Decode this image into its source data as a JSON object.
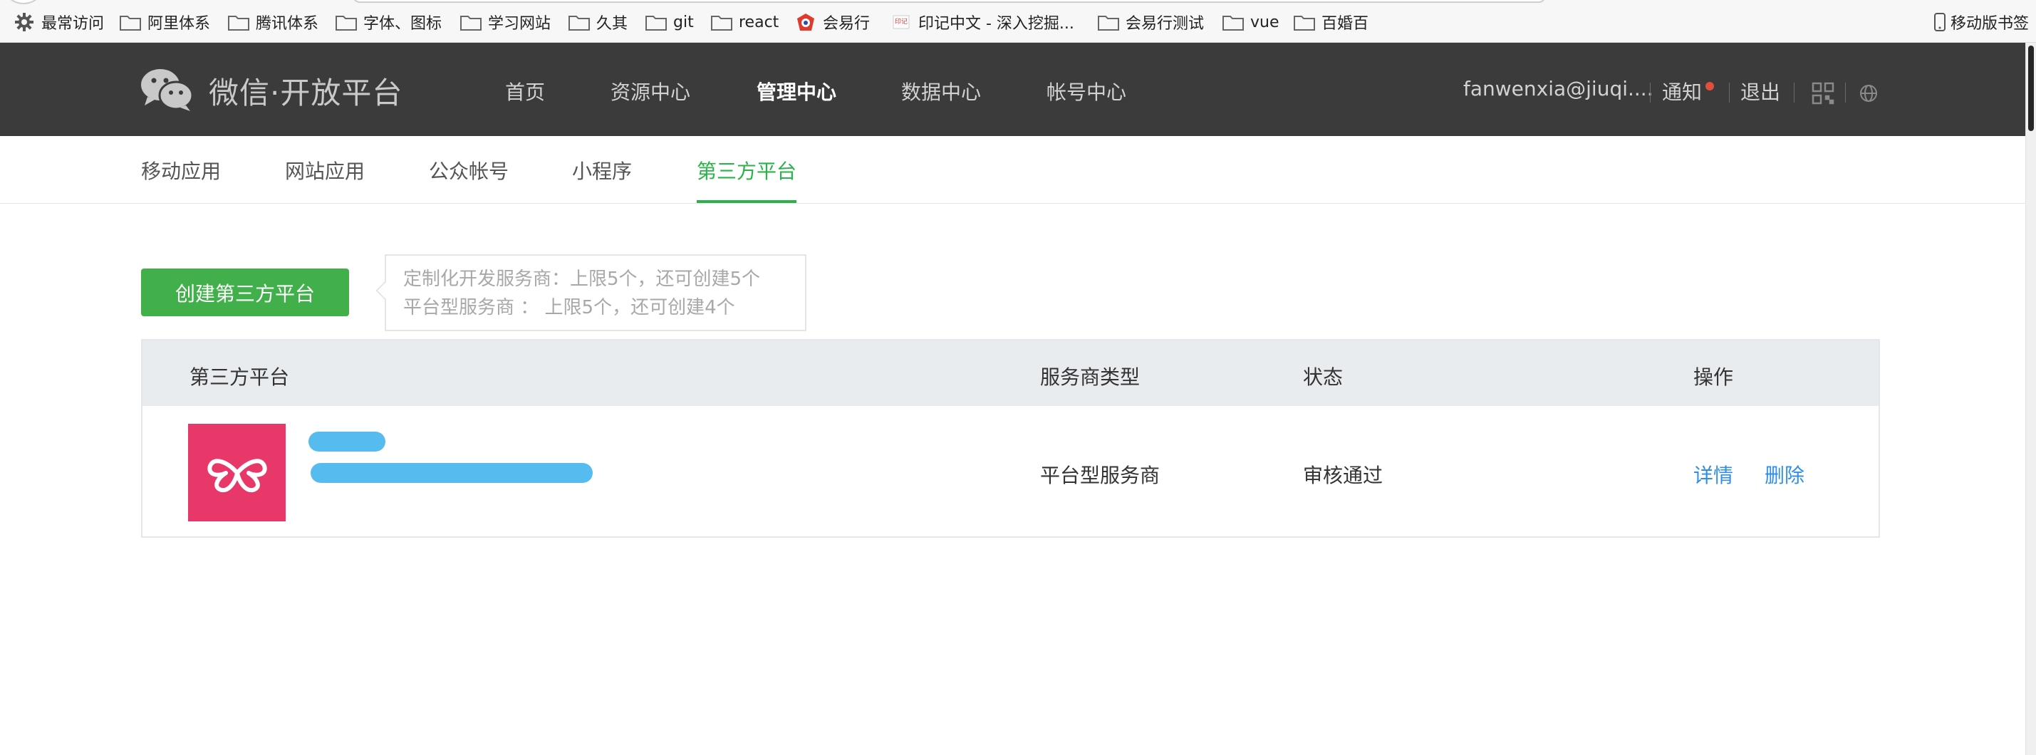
{
  "bookmarks": {
    "items": [
      {
        "label": "最常访问",
        "icon": "gear-icon"
      },
      {
        "label": "阿里体系",
        "icon": "folder-icon"
      },
      {
        "label": "腾讯体系",
        "icon": "folder-icon"
      },
      {
        "label": "字体、图标",
        "icon": "folder-icon"
      },
      {
        "label": "学习网站",
        "icon": "folder-icon"
      },
      {
        "label": "久其",
        "icon": "folder-icon"
      },
      {
        "label": "git",
        "icon": "folder-icon"
      },
      {
        "label": "react",
        "icon": "folder-icon"
      },
      {
        "label": "会易行",
        "icon": "site-favicon-icon"
      },
      {
        "label": "印记中文 - 深入挖掘...",
        "icon": "site-favicon-icon"
      },
      {
        "label": "会易行测试",
        "icon": "folder-icon"
      },
      {
        "label": "vue",
        "icon": "folder-icon"
      },
      {
        "label": "百婚百",
        "icon": "folder-icon"
      }
    ],
    "mobile": "移动版书签"
  },
  "header": {
    "logo_text": "微信·开放平台",
    "nav": [
      "首页",
      "资源中心",
      "管理中心",
      "数据中心",
      "帐号中心"
    ],
    "active_nav": "管理中心",
    "account": "fanwenxia@jiuqi....",
    "notify": "通知",
    "logout": "退出"
  },
  "tabs": {
    "items": [
      "移动应用",
      "网站应用",
      "公众帐号",
      "小程序",
      "第三方平台"
    ],
    "active": "第三方平台"
  },
  "create": {
    "button": "创建第三方平台",
    "tip_line1": "定制化开发服务商：上限5个，还可创建5个",
    "tip_line2": "平台型服务商 ： 上限5个，还可创建4个"
  },
  "table": {
    "headers": [
      "第三方平台",
      "服务商类型",
      "状态",
      "操作"
    ],
    "rows": [
      {
        "type": "平台型服务商",
        "status": "审核通过",
        "actions": [
          "详情",
          "删除"
        ]
      }
    ]
  },
  "colors": {
    "accent_green": "#2bb24a",
    "button_green": "#41b04a",
    "link_blue": "#2f8fe6",
    "nav_bg": "#3b3b3b",
    "app_logo": "#e8386a"
  }
}
